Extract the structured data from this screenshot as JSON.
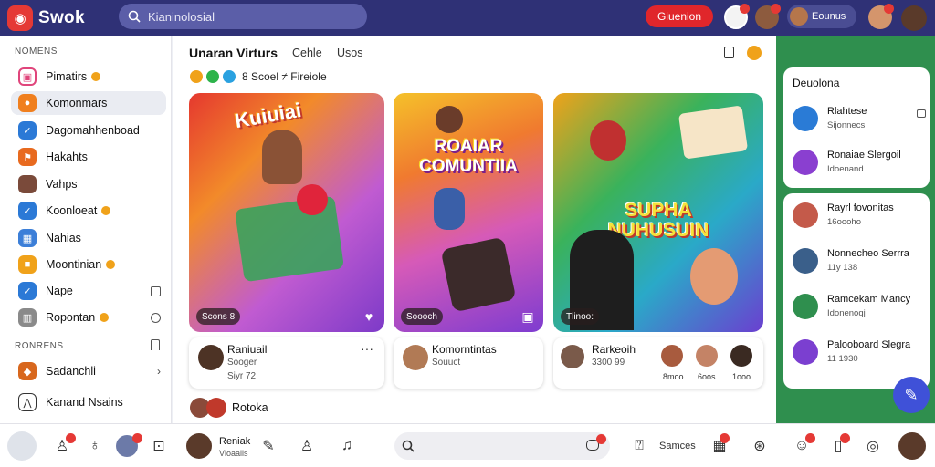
{
  "app": {
    "name": "Swok"
  },
  "search": {
    "query": "Kianinolosial"
  },
  "topbar": {
    "primary_button": "Giuenion",
    "pill_label": "Eounus"
  },
  "sidebar": {
    "section1": "NOMENS",
    "items": [
      {
        "label": "Pimatirs"
      },
      {
        "label": "Komonmars"
      },
      {
        "label": "Dagomahhenboad"
      },
      {
        "label": "Hakahts"
      },
      {
        "label": "Vahps"
      },
      {
        "label": "Koonloeat"
      },
      {
        "label": "Nahias"
      },
      {
        "label": "Moontinian"
      },
      {
        "label": "Nape"
      },
      {
        "label": "Ropontan"
      }
    ],
    "section2": "RONRENS",
    "items2": [
      {
        "label": "Sadanchli"
      },
      {
        "label": "Kanand Nsains"
      }
    ]
  },
  "main": {
    "title": "Unaran Virturs",
    "tabs": [
      "Cehle",
      "Usos"
    ],
    "filter_text": "8 Scoel ≠ Fireiole",
    "cards": [
      {
        "badge": "Scons 8",
        "heading": "Kuiuiai"
      },
      {
        "badge": "Soooch",
        "heading": "ROAIAR COMUNTIIA"
      },
      {
        "badge": "Tlinoo:",
        "heading": "SUPHA NUHUSUIN"
      }
    ],
    "infos": [
      {
        "name": "Raniuail",
        "sub": "Sooger",
        "meta": "Siyr 72"
      },
      {
        "name": "Komorntintas",
        "sub": "Souuct"
      },
      {
        "name": "Rarkeoih",
        "sub": "3300 99",
        "mini": [
          "8moo",
          "6oos",
          "1ooo"
        ]
      }
    ],
    "more": {
      "label": "Rotoka"
    }
  },
  "right": {
    "header": "Deuolona",
    "rows": [
      {
        "name": "Rlahtese",
        "sub": "Sijonnecs"
      },
      {
        "name": "Ronaiae Slergoil",
        "sub": "Idoenand"
      },
      {
        "name": "Rayrl fovonitas",
        "sub": "16oooho"
      },
      {
        "name": "Nonnecheo Serrra",
        "sub": "11y 138"
      },
      {
        "name": "Ramcekam Mancy",
        "sub": "Idonenoqj"
      },
      {
        "name": "Palooboard Slegra",
        "sub": "11 1930"
      }
    ]
  },
  "bottombar": {
    "user_name": "Reniak",
    "user_sub": "Vloaaiis",
    "games_label": "Samces"
  }
}
